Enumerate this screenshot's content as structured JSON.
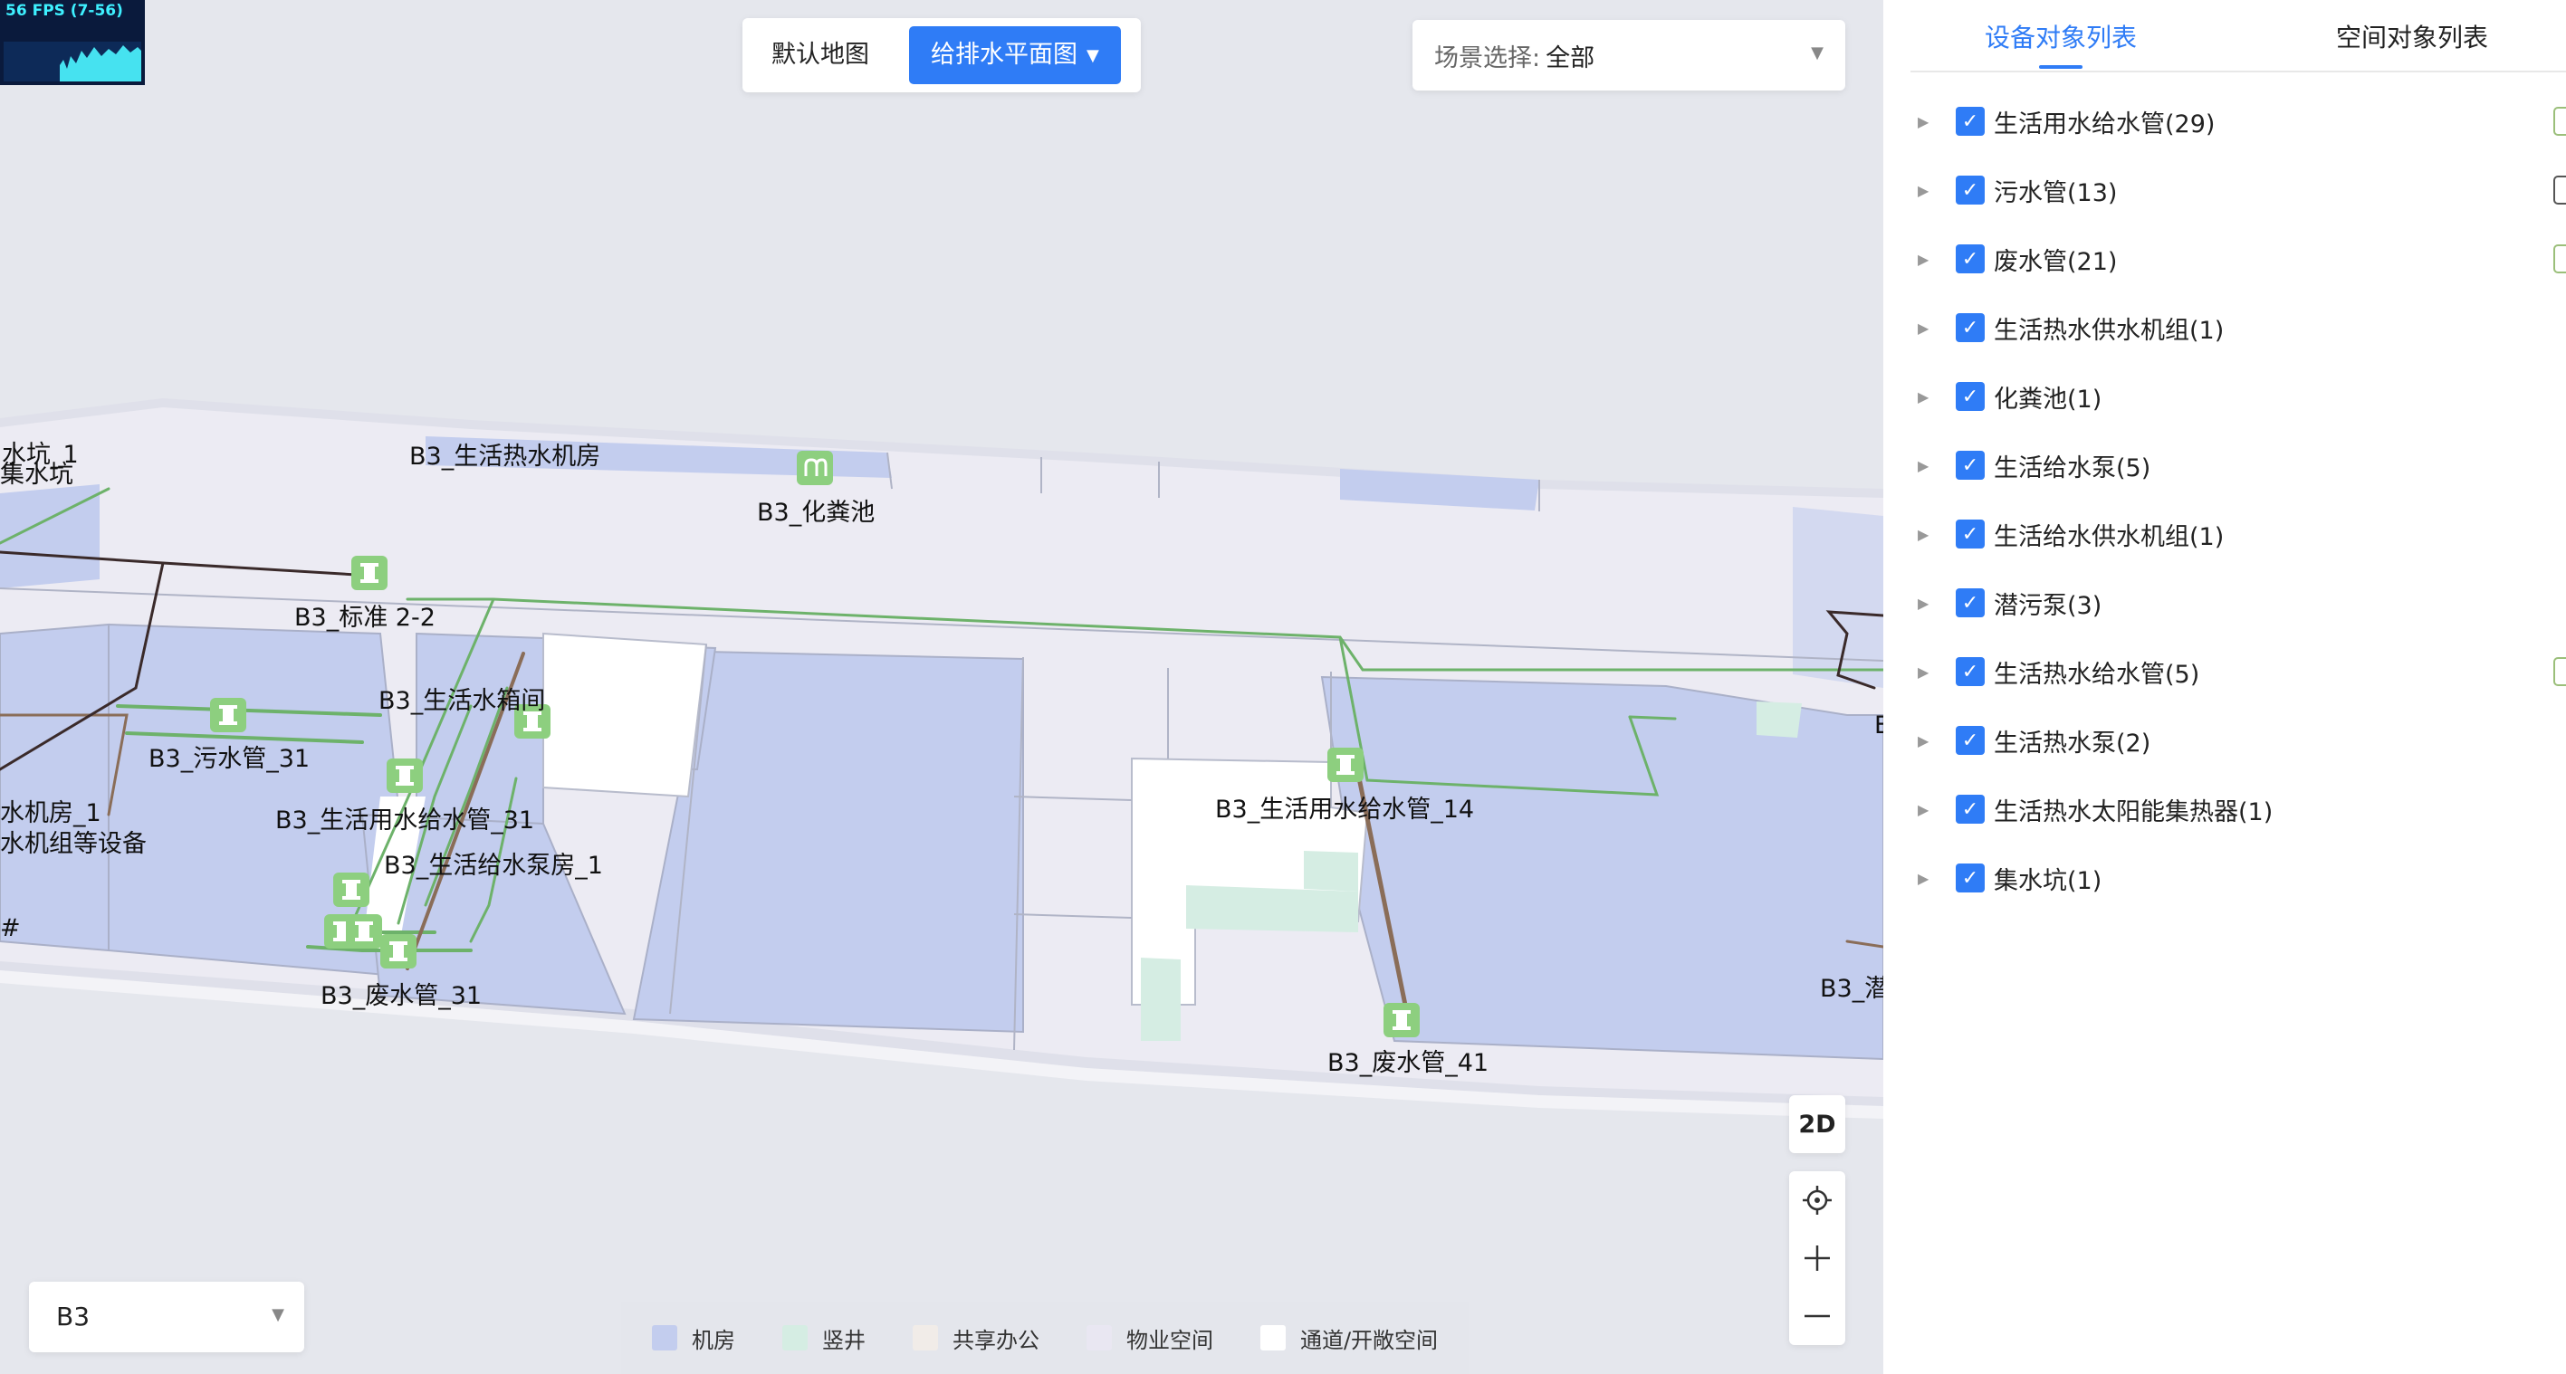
{
  "fps": {
    "label": "56 FPS (7-56)"
  },
  "map_tabs": [
    {
      "label": "默认地图",
      "active": false
    },
    {
      "label": "给排水平面图",
      "active": true
    }
  ],
  "scene": {
    "label": "场景选择:",
    "value": "全部"
  },
  "floor": {
    "value": "B3"
  },
  "controls": {
    "view_2d": "2D"
  },
  "legend": [
    {
      "label": "机房",
      "color": "#c3cdee"
    },
    {
      "label": "竖井",
      "color": "#d5ede3"
    },
    {
      "label": "共享办公",
      "color": "#f1ece8"
    },
    {
      "label": "物业空间",
      "color": "#e9e7f2"
    },
    {
      "label": "通道/开敞空间",
      "color": "#ffffff"
    }
  ],
  "map_labels": [
    "水坑_1",
    "集水坑",
    "B3_生活热水机房",
    "B3_化粪池",
    "B3_标准 2-2",
    "B3_生活水箱间",
    "B3_污水管_31",
    "水机房_1",
    "水机组等设备",
    "B3_生活用水给水管_31",
    "B3_生活给水泵房_1",
    "B3_生活用水给水管_14",
    "B3_废水管_31",
    "B3_废水管_41",
    "B3_潜",
    "E",
    "#"
  ],
  "panel": {
    "tabs": [
      {
        "label": "设备对象列表",
        "active": true
      },
      {
        "label": "空间对象列表",
        "active": false
      }
    ],
    "items": [
      {
        "label": "生活用水给水管(29)",
        "checked": true
      },
      {
        "label": "污水管(13)",
        "checked": true
      },
      {
        "label": "废水管(21)",
        "checked": true
      },
      {
        "label": "生活热水供水机组(1)",
        "checked": true
      },
      {
        "label": "化粪池(1)",
        "checked": true
      },
      {
        "label": "生活给水泵(5)",
        "checked": true
      },
      {
        "label": "生活给水供水机组(1)",
        "checked": true
      },
      {
        "label": "潜污泵(3)",
        "checked": true
      },
      {
        "label": "生活热水给水管(5)",
        "checked": true
      },
      {
        "label": "生活热水泵(2)",
        "checked": true
      },
      {
        "label": "生活热水太阳能集热器(1)",
        "checked": true
      },
      {
        "label": "集水坑(1)",
        "checked": true
      }
    ]
  },
  "colors": {
    "accent": "#2f7cf6",
    "pipe_green": "#6db26a",
    "pipe_brown": "#8a6d58",
    "pipe_dark": "#3a2a2a",
    "marker": "#8dcf7f"
  }
}
